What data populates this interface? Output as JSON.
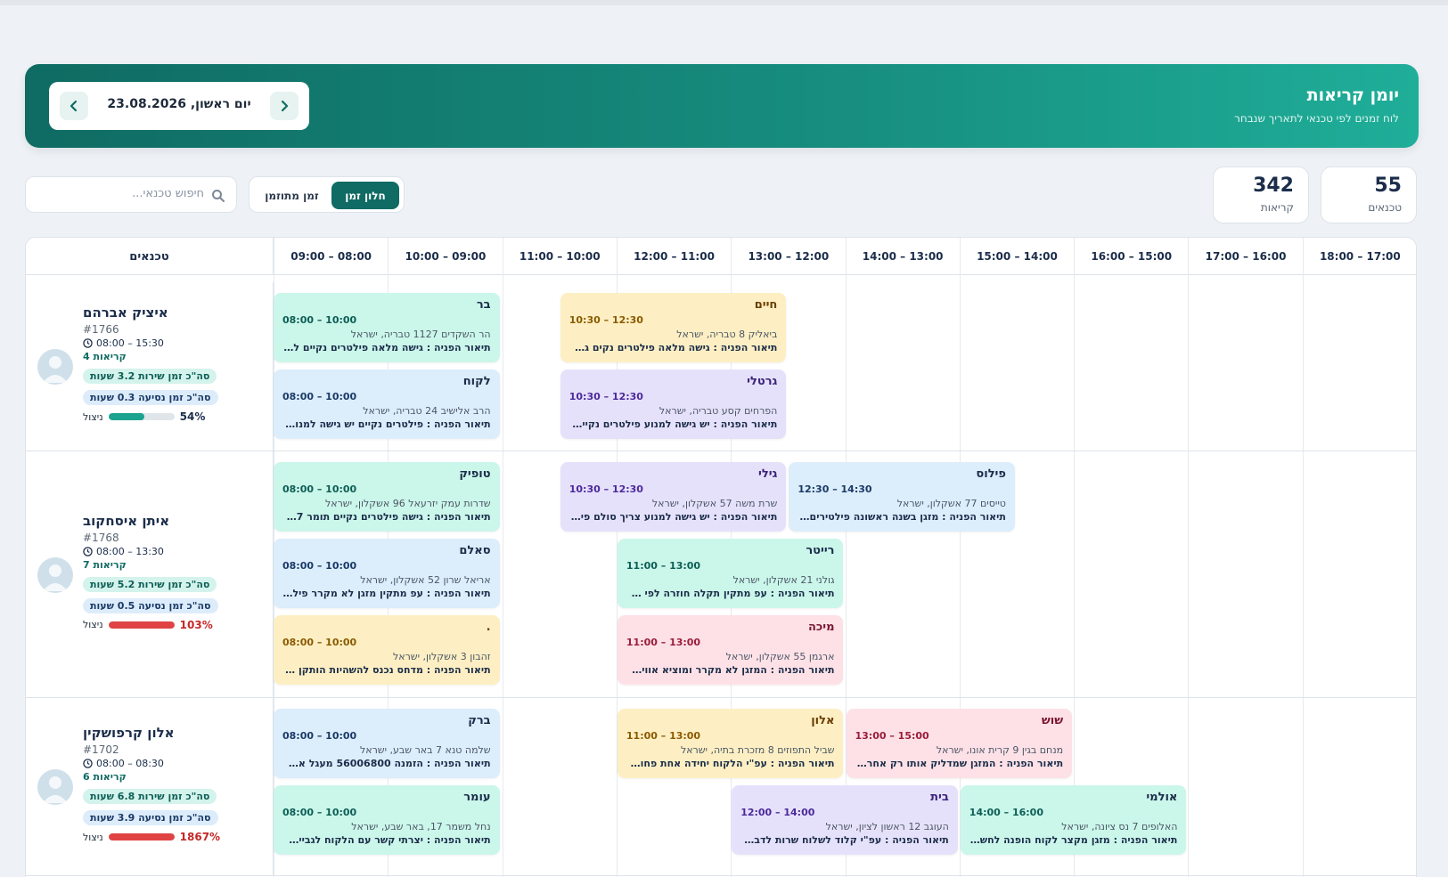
{
  "header": {
    "title": "יומן קריאות",
    "subtitle": "לוח זמנים לפי טכנאי לתאריך שנבחר",
    "date": "יום ראשון, 23.08.2026",
    "prev_icon": "chevron-right-icon",
    "next_icon": "chevron-left-icon"
  },
  "stats": {
    "techs": {
      "value": "55",
      "label": "טכנאים"
    },
    "calls": {
      "value": "342",
      "label": "קריאות"
    }
  },
  "toolbar": {
    "view_window": "חלון זמן",
    "view_planned": "זמן מתוזמן",
    "search_placeholder": "חיפוש טכנאי..."
  },
  "grid": {
    "tech_header": "טכנאים",
    "slots": [
      "08:00 – 09:00",
      "09:00 – 10:00",
      "10:00 – 11:00",
      "11:00 – 12:00",
      "12:00 – 13:00",
      "13:00 – 14:00",
      "14:00 – 15:00",
      "15:00 – 16:00",
      "16:00 – 17:00",
      "17:00 – 18:00"
    ]
  },
  "rows": [
    {
      "name": "איציק אברהם",
      "id": "#1766",
      "hours": "08:00 – 15:30",
      "calls": "4 קריאות",
      "service": "סה\"כ זמן שירות 3.2 שעות",
      "travel": "סה\"כ זמן נסיעה 0.3 שעות",
      "util_label": "ניצול",
      "util_pct": "54%",
      "util_value": 54,
      "util_color": "#1aa38f",
      "cards": [
        {
          "name": "בר",
          "time": "08:00 – 10:00",
          "addr": "הר השקדים 1127 טבריה, ישראל",
          "desc": "תיאור הפניה : גישה מלאה פילטרים נקיים לא ...",
          "color": "mint"
        },
        {
          "name": "לקוח",
          "time": "08:00 – 10:00",
          "addr": "הרב אלישיב 24 טבריה, ישראל",
          "desc": "תיאור הפניה : פילטרים נקיים יש גישה למנוע י...",
          "color": "blue"
        },
        {
          "name": "חיים",
          "time": "10:30 – 12:30",
          "addr": "ביאליק 8 טבריה, ישראל",
          "desc": "תיאור הפניה : גישה מלאה פילטרים נקים גם ה...",
          "color": "yellow"
        },
        {
          "name": "גרטלי",
          "time": "10:30 – 12:30",
          "addr": "הפרחים קסע טבריה, ישראל",
          "desc": "תיאור הפניה : יש גישה למנוע פילטרים נקיים ...",
          "color": "purple"
        }
      ]
    },
    {
      "name": "איתן איסחקוב",
      "id": "#1768",
      "hours": "08:00 – 13:30",
      "calls": "7 קריאות",
      "service": "סה\"כ זמן שירות 5.2 שעות",
      "travel": "סה\"כ זמן נסיעה 0.5 שעות",
      "util_label": "ניצול",
      "util_pct": "103%",
      "util_value": 103,
      "util_color": "#e04343",
      "cards": [
        {
          "name": "טופיק",
          "time": "08:00 – 10:00",
          "addr": "שדרות עמק יזרעאל 96 אשקלון, ישראל",
          "desc": "תיאור הפניה : גישה פילטרים נקיים תומר 9877...",
          "color": "mint"
        },
        {
          "name": "סאלם",
          "time": "08:00 – 10:00",
          "addr": "אריאל שרון 52 אשקלון, ישראל",
          "desc": "תיאור הפניה : עפ מתקין מזגן לא מקרר פילטרי...",
          "color": "blue"
        },
        {
          "name": ".",
          "time": "08:00 – 10:00",
          "addr": "זהבון 3 אשקלון, ישראל",
          "desc": "תיאור הפניה : מדחס נכנס להשהיות הותקן שב...",
          "color": "yellow"
        },
        {
          "name": "גילי",
          "time": "10:30 – 12:30",
          "addr": "שרת משה 57 אשקלון, ישראל",
          "desc": "תיאור הפניה : יש גישה למנוע צריך סולם פילט...",
          "color": "purple"
        },
        {
          "name": "פילוס",
          "time": "12:30 – 14:30",
          "addr": "טייסים 77 אשקלון, ישראל",
          "desc": "תיאור הפניה : מזגן בשנה ראשונה פילטירים נ...",
          "color": "blue"
        },
        {
          "name": "רייטר",
          "time": "11:00 – 13:00",
          "addr": "גולני 21 אשקלון, ישראל",
          "desc": "תיאור הפניה : עפ מתקין תקלה חוזרה לפי קריא...",
          "color": "mint"
        },
        {
          "name": "מיכה",
          "time": "11:00 – 13:00",
          "addr": "ארגמן 55 אשקלון, ישראל",
          "desc": "תיאור הפניה : המזגן לא מקרר ומוציא אוויר הל...",
          "color": "pink"
        }
      ]
    },
    {
      "name": "אלון קרפושקין",
      "id": "#1702",
      "hours": "08:00 – 08:30",
      "calls": "6 קריאות",
      "service": "סה\"כ זמן שירות 6.8 שעות",
      "travel": "סה\"כ זמן נסיעה 3.9 שעות",
      "util_label": "ניצול",
      "util_pct": "1867%",
      "util_value": 1867,
      "util_color": "#e04343",
      "cards": [
        {
          "name": "ברק",
          "time": "08:00 – 10:00",
          "addr": "שלמה טנא 7 באר שבע, ישראל",
          "desc": "תיאור הפניה : הזמנה 56006800 מעגל אחד מ...",
          "color": "blue"
        },
        {
          "name": "עומר",
          "time": "08:00 – 10:00",
          "addr": "נחל משמר 17, באר שבע, ישראל",
          "desc": "תיאור הפניה : יצרתי קשר עם הלקוח לגביית ת...",
          "color": "mint"
        },
        {
          "name": "אלון",
          "time": "11:00 – 13:00",
          "addr": "שביל התפוזים 8 מזכרת בתיה, ישראל",
          "desc": "תיאור הפניה : עפ\"י הלקוח יחידה אחת פחות מ...",
          "color": "yellow"
        },
        {
          "name": "שוש",
          "time": "13:00 – 15:00",
          "addr": "מנחם בגין 9 קרית אונו, ישראל",
          "desc": "תיאור הפניה : המזגן שמדליק אותו רק אחרי 15...",
          "color": "pink"
        },
        {
          "name": "בית",
          "time": "12:00 – 14:00",
          "addr": "העוגב 12 ראשון לציון, ישראל",
          "desc": "תיאור הפניה : עפ\"י קלוד לשלוח שרות לדבר ע...",
          "color": "purple"
        },
        {
          "name": "אולמי",
          "time": "14:00 – 16:00",
          "addr": "האלופים 7 נס ציונה, ישראל",
          "desc": "תיאור הפניה : מזגן מקצר לקוח הופנה לחשמל...",
          "color": "mint"
        }
      ]
    }
  ]
}
